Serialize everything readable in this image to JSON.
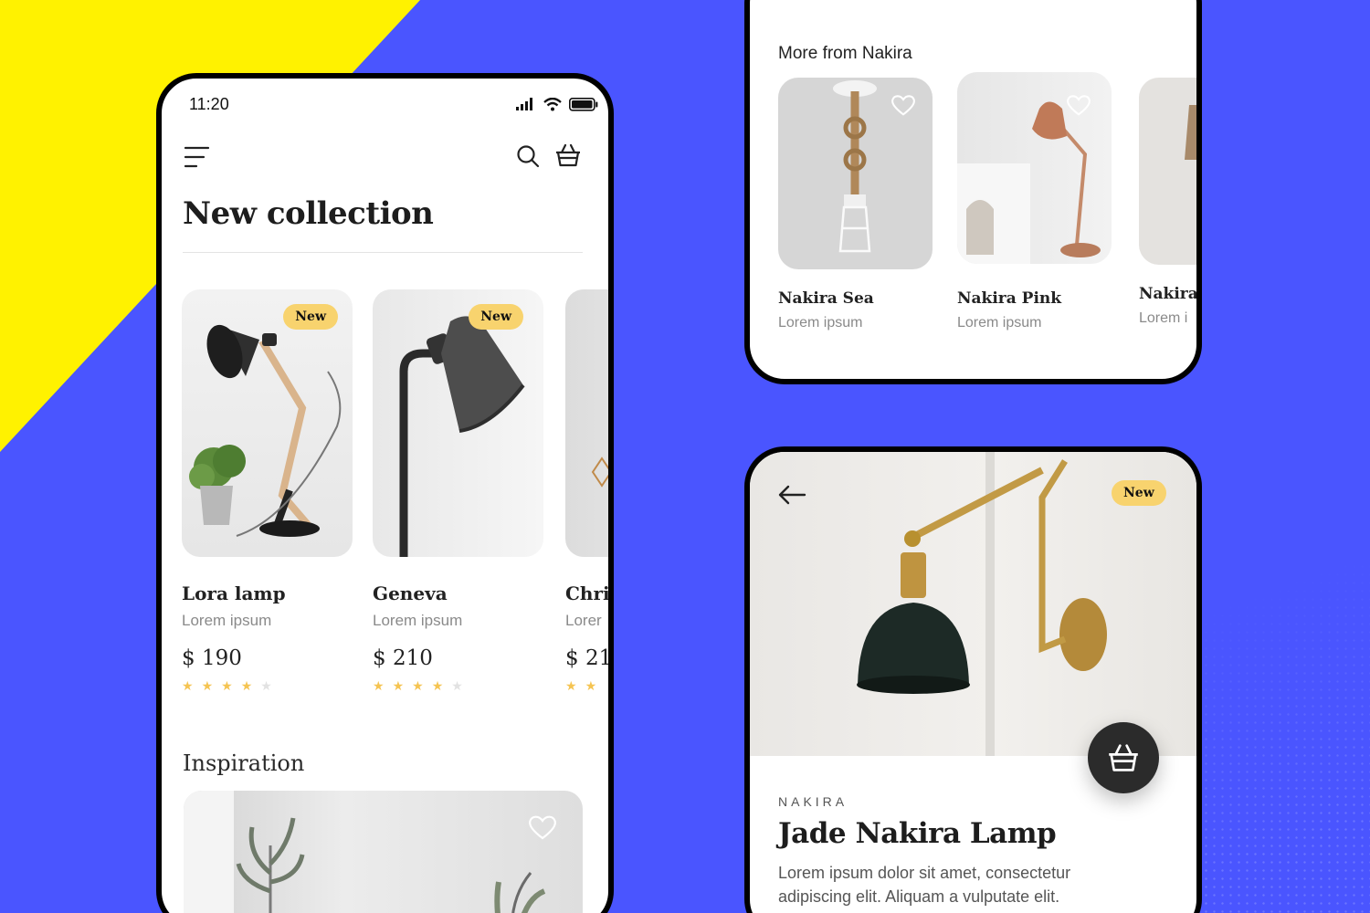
{
  "colors": {
    "background": "#4a55ff",
    "accent_yellow": "#fff200",
    "badge": "#f8d36e",
    "star": "#f5c452",
    "fab": "#2b2b2b"
  },
  "phone_main": {
    "status": {
      "time": "11:20"
    },
    "header": {
      "menu_icon": "hamburger-menu-icon",
      "search_icon": "search-icon",
      "cart_icon": "basket-icon"
    },
    "title": "New collection",
    "products": [
      {
        "name": "Lora lamp",
        "subtitle": "Lorem ipsum",
        "price": "$ 190",
        "badge": "New",
        "rating": 4,
        "rating_max": 5
      },
      {
        "name": "Geneva",
        "subtitle": "Lorem ipsum",
        "price": "$ 210",
        "badge": "New",
        "rating": 4,
        "rating_max": 5
      },
      {
        "name": "Chri",
        "subtitle": "Lorer",
        "price": "$ 21(",
        "rating": 2,
        "rating_max": 2
      }
    ],
    "inspiration": {
      "title": "Inspiration",
      "heart_icon": "heart-icon"
    }
  },
  "phone_more": {
    "title": "More from Nakira",
    "items": [
      {
        "name": "Nakira Sea",
        "subtitle": "Lorem ipsum"
      },
      {
        "name": "Nakira Pink",
        "subtitle": "Lorem ipsum"
      },
      {
        "name": "Nakira (",
        "subtitle": "Lorem i"
      }
    ]
  },
  "phone_detail": {
    "back_icon": "arrow-left-icon",
    "badge": "New",
    "brand": "NAKIRA",
    "title": "Jade Nakira Lamp",
    "description": "Lorem ipsum dolor sit amet, consectetur adipiscing elit. Aliquam a vulputate elit.",
    "cart_icon": "basket-icon"
  }
}
